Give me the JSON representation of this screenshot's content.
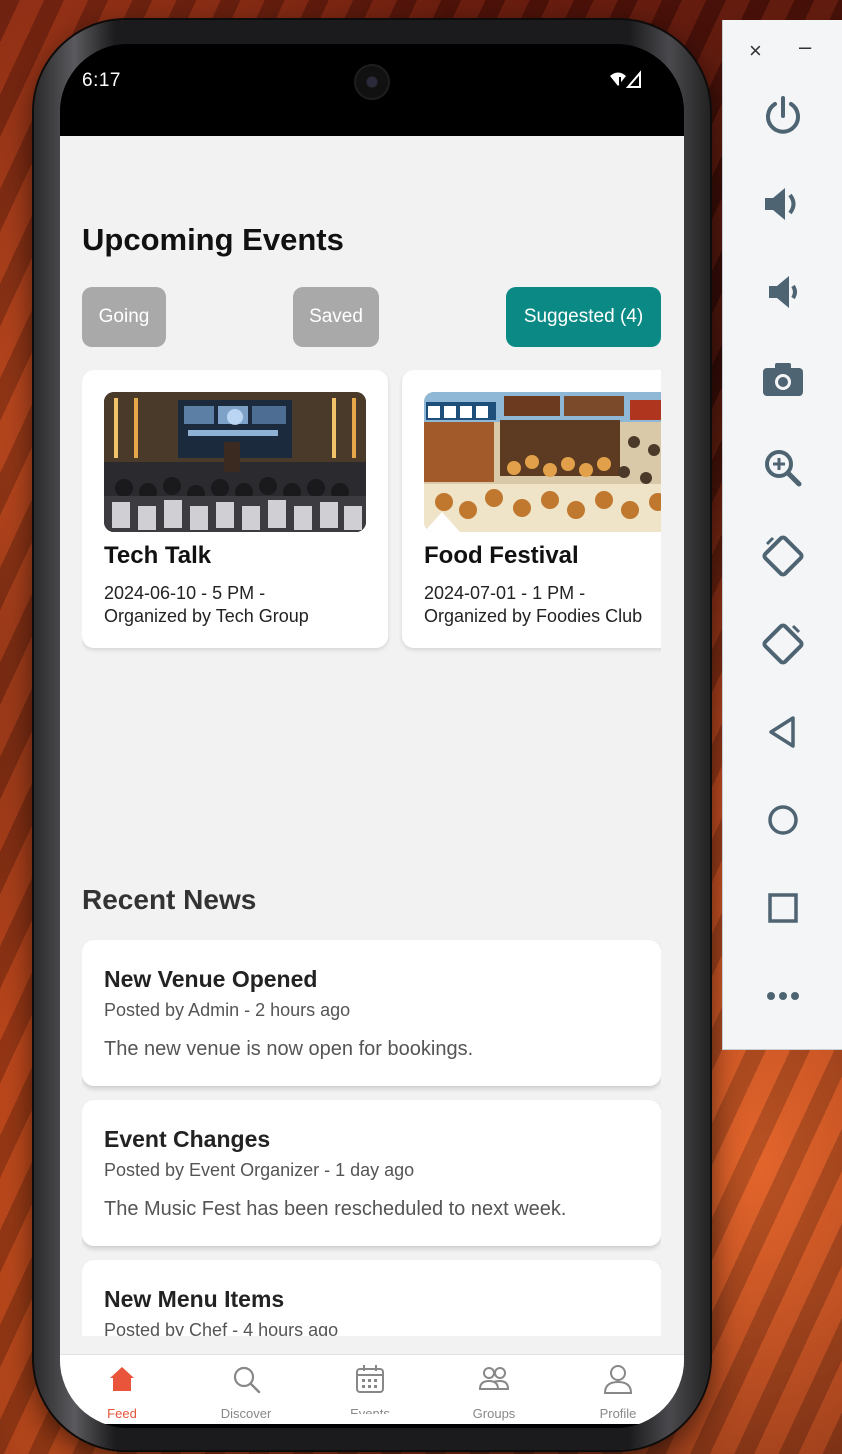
{
  "status_bar": {
    "time": "6:17",
    "icons": "wifi-signal"
  },
  "events": {
    "title": "Upcoming Events",
    "filters": [
      {
        "label": "Going",
        "color": "#a9a9a9"
      },
      {
        "label": "Saved",
        "color": "#a9a9a9"
      },
      {
        "label": "Suggested (4)",
        "color": "#0b8a85"
      }
    ],
    "cards": [
      {
        "name": "Tech Talk",
        "date": "2024-06-10 - 5 PM -",
        "organizer": "Organized by Tech Group"
      },
      {
        "name": "Food Festival",
        "date": "2024-07-01 - 1 PM -",
        "organizer": "Organized by Foodies Club"
      }
    ]
  },
  "news": {
    "title": "Recent News",
    "items": [
      {
        "headline": "New Venue Opened",
        "byline": "Posted by Admin - 2 hours ago",
        "body": "The new venue is now open for bookings."
      },
      {
        "headline": "Event Changes",
        "byline": "Posted by Event Organizer - 1 day ago",
        "body": "The Music Fest has been rescheduled to next week."
      },
      {
        "headline": "New Menu Items",
        "byline": "Posted by Chef - 4 hours ago",
        "body": ""
      }
    ]
  },
  "nav": {
    "items": [
      {
        "label": "Feed",
        "icon": "home-icon",
        "active": true
      },
      {
        "label": "Discover",
        "icon": "search-icon",
        "active": false
      },
      {
        "label": "Events",
        "icon": "calendar-icon",
        "active": false
      },
      {
        "label": "Groups",
        "icon": "groups-icon",
        "active": false
      },
      {
        "label": "Profile",
        "icon": "profile-icon",
        "active": false
      }
    ],
    "active_color": "#e8553b"
  },
  "emulator": {
    "close": "×",
    "minimize": "–",
    "buttons": [
      "power-icon",
      "volume-up-icon",
      "volume-down-icon",
      "camera-icon",
      "zoom-icon",
      "rotate-left-icon",
      "rotate-right-icon",
      "back-icon",
      "home-circle-icon",
      "overview-icon",
      "more-icon"
    ]
  }
}
